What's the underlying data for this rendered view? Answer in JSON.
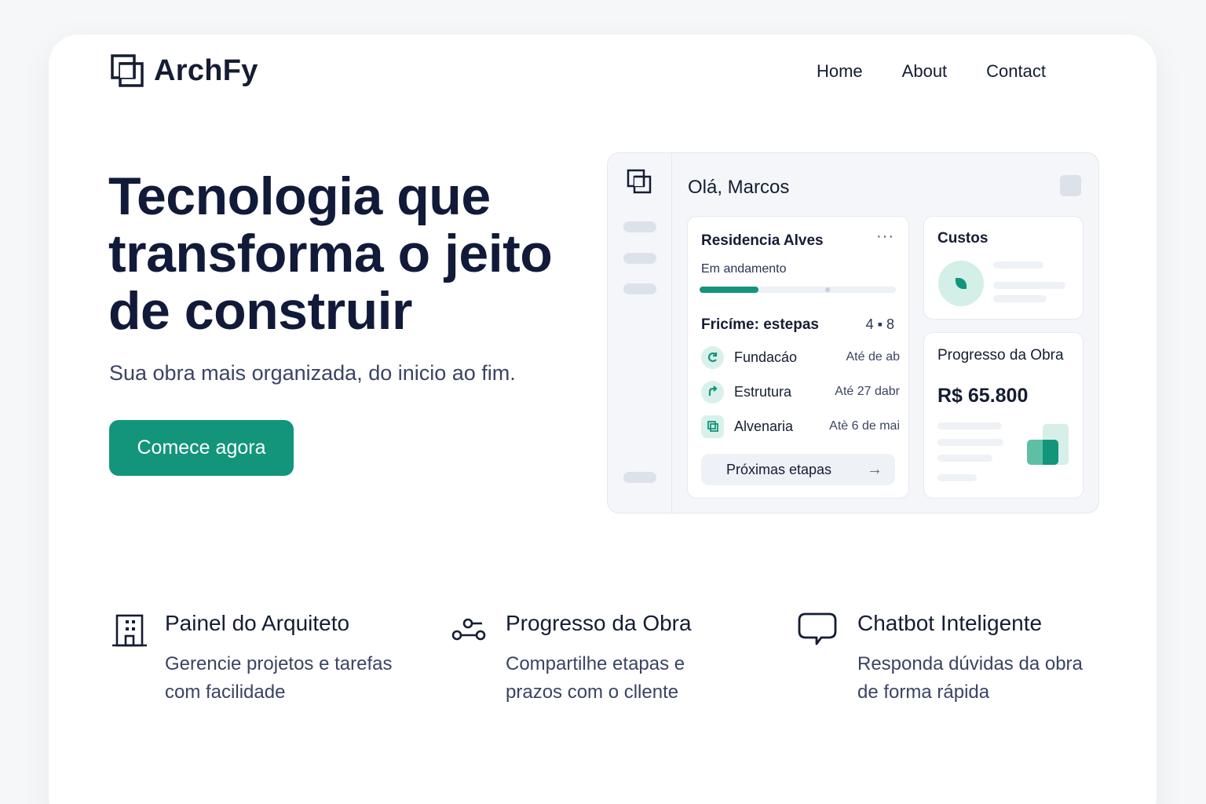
{
  "brand": {
    "name": "ArchFy",
    "logo_icon": "archfy-logo-icon"
  },
  "nav": {
    "items": [
      "Home",
      "About",
      "Contact"
    ]
  },
  "hero": {
    "title_lines": [
      "Tecnologia que",
      "transforma o jeito",
      "de construir"
    ],
    "subtitle": "Sua obra mais organizada, do inicio ao fim.",
    "cta_label": "Comece agora"
  },
  "dashboard": {
    "greeting": "Olá, Marcos",
    "project": {
      "title": "Residencia Alves",
      "menu": "···",
      "status": "Em andamento",
      "progress_fraction": 0.3,
      "stages_title": "Fricíme: estepas",
      "stages_count": "4 ▪ 8",
      "stages": [
        {
          "name": "Fundacáo",
          "date": "Até de ab",
          "icon": "refresh-icon"
        },
        {
          "name": "Estrutura",
          "date": "Até 27 dabr",
          "icon": "arrow-up-right-icon"
        },
        {
          "name": "Alvenaria",
          "date": "Atè 6 de mai",
          "icon": "layers-icon"
        }
      ],
      "next_label": "Próximas etapas",
      "next_icon": "arrow-right-icon"
    },
    "costs": {
      "title": "Custos",
      "icon": "leaf-icon"
    },
    "progress": {
      "title": "Progresso da Obra",
      "value": "R$ 65.800"
    }
  },
  "features": [
    {
      "title": "Painel do Arquiteto",
      "desc_lines": [
        "Gerencie projetos e tarefas",
        "com facilidade"
      ],
      "icon": "building-icon"
    },
    {
      "title": "Progresso da Obra",
      "desc_lines": [
        "Compartilhe etapas e",
        "prazos com o cllente"
      ],
      "icon": "timeline-nodes-icon"
    },
    {
      "title": "Chatbot Inteligente",
      "desc_lines": [
        "Responda dúvidas da obra",
        "de forma rápida"
      ],
      "icon": "chat-bubble-icon"
    }
  ],
  "colors": {
    "accent": "#12957a",
    "text": "#151d33",
    "muted": "#3a4463"
  }
}
